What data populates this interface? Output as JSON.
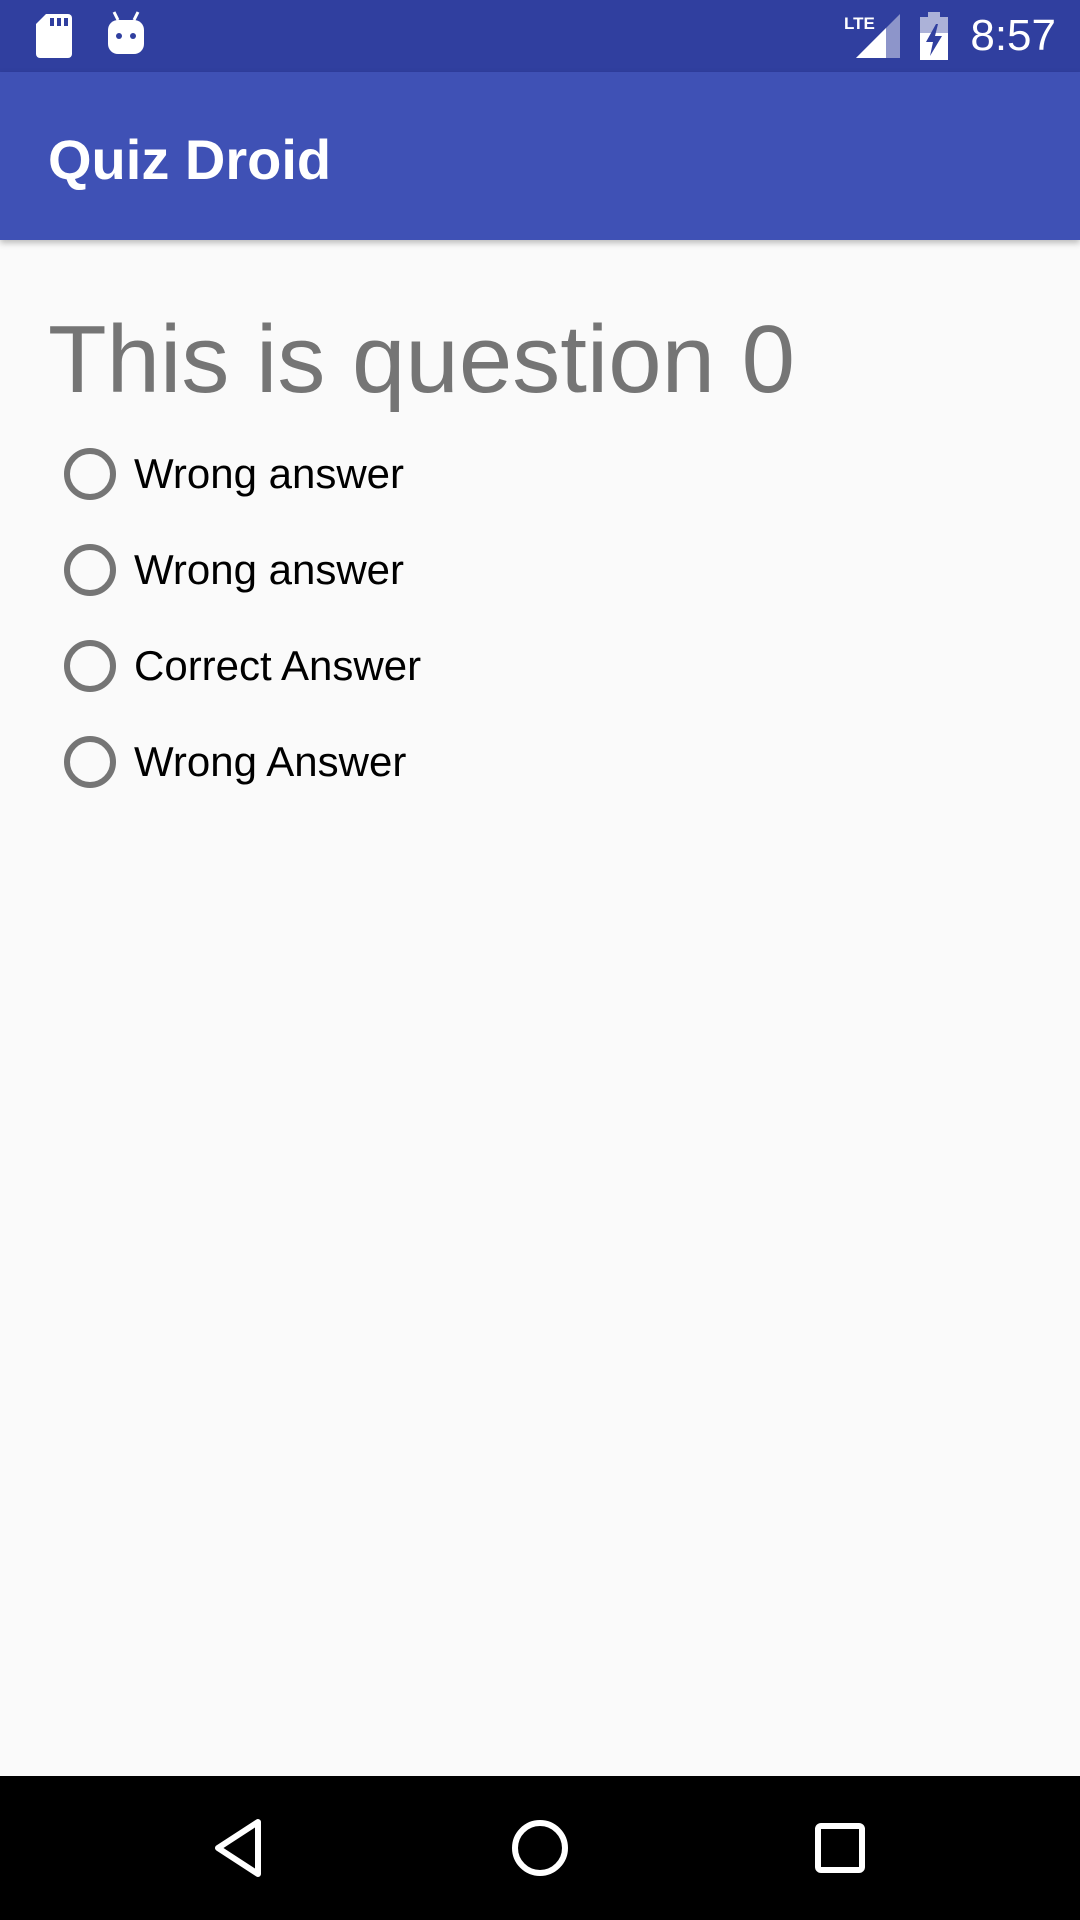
{
  "status_bar": {
    "time": "8:57",
    "network_label": "LTE",
    "icons": [
      "sd-card-icon",
      "android-debug-icon",
      "lte-signal-icon",
      "battery-charging-icon"
    ],
    "background": "#303f9f"
  },
  "app_bar": {
    "title": "Quiz Droid",
    "background": "#3f51b5"
  },
  "question": {
    "text": "This is question 0",
    "color": "#757575"
  },
  "options": [
    {
      "label": "Wrong answer",
      "selected": false
    },
    {
      "label": "Wrong answer",
      "selected": false
    },
    {
      "label": "Correct Answer",
      "selected": false
    },
    {
      "label": "Wrong Answer",
      "selected": false
    }
  ],
  "nav_bar": {
    "icons": [
      "back-icon",
      "home-icon",
      "recents-icon"
    ]
  }
}
